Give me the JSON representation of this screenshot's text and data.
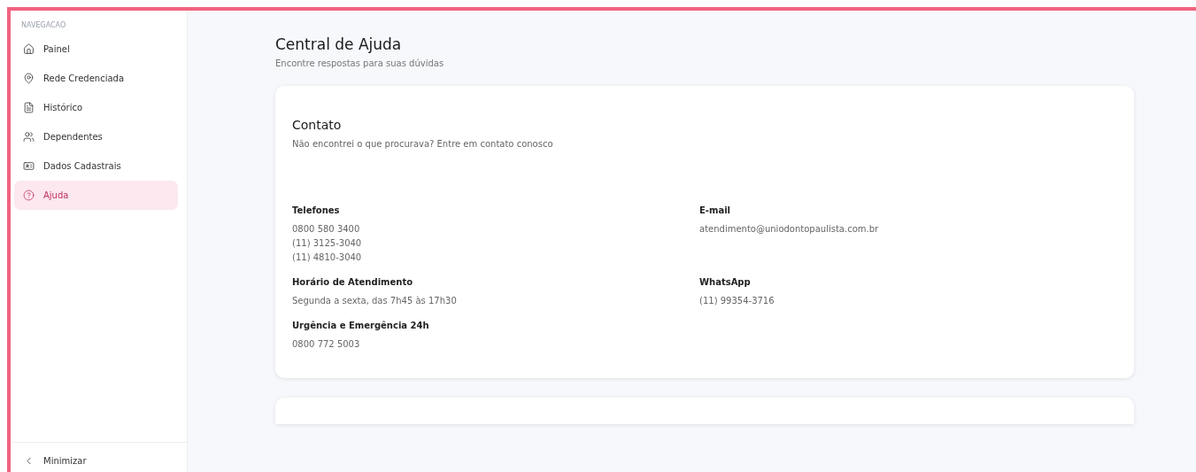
{
  "sidebar": {
    "section_label": "NAVEGACAO",
    "items": [
      {
        "label": "Painel",
        "kind": "home",
        "selected": false
      },
      {
        "label": "Rede Credenciada",
        "kind": "network",
        "selected": false
      },
      {
        "label": "Histórico",
        "kind": "history",
        "selected": false
      },
      {
        "label": "Dependentes",
        "kind": "dependents",
        "selected": false
      },
      {
        "label": "Dados Cadastrais",
        "kind": "registration",
        "selected": false
      },
      {
        "label": "Ajuda",
        "kind": "help",
        "selected": true
      }
    ],
    "collapse": {
      "label": "Minimizar"
    }
  },
  "page": {
    "title": "Central de Ajuda",
    "subtitle": "Encontre respostas para suas dúvidas"
  },
  "contact": {
    "title": "Contato",
    "subtitle": "Não encontrei o que procurava? Entre em contato conosco",
    "items": [
      {
        "label": "Telefones",
        "values": [
          "0800 580 3400",
          "(11) 3125-3040",
          "(11) 4810-3040"
        ]
      },
      {
        "label": "E-mail",
        "values": [
          "atendimento@uniodontopaulista.com.br"
        ]
      },
      {
        "label": "Horário de Atendimento",
        "values": [
          "Segunda a sexta, das 7h45 às 17h30"
        ]
      },
      {
        "label": "WhatsApp",
        "values": [
          "(11) 99354-3716"
        ]
      },
      {
        "label": "Urgência e Emergência 24h",
        "values": [
          "0800 772 5003"
        ]
      }
    ]
  }
}
